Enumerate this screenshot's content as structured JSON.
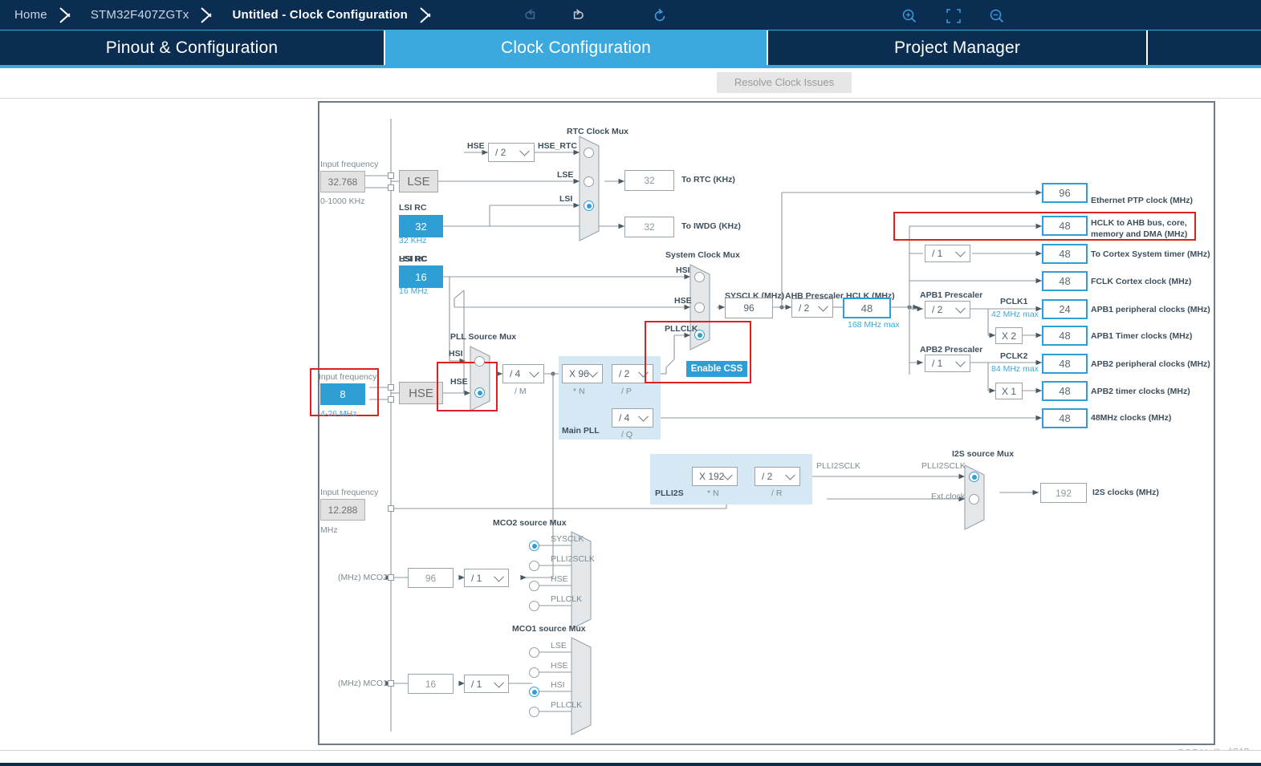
{
  "breadcrumb": {
    "items": [
      {
        "label": "Home",
        "active": false
      },
      {
        "label": "STM32F407ZGTx",
        "active": false
      },
      {
        "label": "Untitled - Clock Configuration",
        "active": true
      }
    ]
  },
  "tabs": [
    {
      "label": "Pinout & Configuration",
      "selected": false
    },
    {
      "label": "Clock Configuration",
      "selected": true
    },
    {
      "label": "Project Manager",
      "selected": false
    }
  ],
  "toolbar": {
    "undo_icon": "undo-icon",
    "redo_icon": "redo-icon",
    "reset_icon": "reset-icon",
    "resolve_label": "Resolve Clock Issues",
    "zoom_in_icon": "zoom-in-icon",
    "fit_icon": "fit-to-screen-icon",
    "zoom_out_icon": "zoom-out-icon"
  },
  "colors": {
    "navy": "#0b2d52",
    "accent_blue": "#3ba9dd",
    "fill_blue": "#2e9fd4",
    "highlight_red": "#e02020",
    "pll_bg": "#d7e8f5"
  },
  "clock": {
    "lse": {
      "input_frequency_label": "Input frequency",
      "value": "32.768",
      "range": "0-1000 KHz",
      "name": "LSE"
    },
    "lsi": {
      "title": "LSI RC",
      "value": "32",
      "unit": "32 KHz"
    },
    "hsi": {
      "title": "HSI RC",
      "value": "16",
      "unit": "16 MHz"
    },
    "hse": {
      "input_frequency_label": "Input frequency",
      "value": "8",
      "range": "4-26 MHz",
      "name": "HSE"
    },
    "i2s_input": {
      "input_frequency_label": "Input frequency",
      "value": "12.288",
      "unit": "MHz"
    },
    "rtc_mux": {
      "title": "RTC Clock Mux",
      "hse_label": "HSE",
      "hse_div": "/ 2",
      "hse_rtc_label": "HSE_RTC",
      "inputs": [
        "HSE_RTC",
        "LSE",
        "LSI"
      ],
      "selected": 2
    },
    "to_rtc": {
      "value": "32",
      "label": "To RTC (KHz)"
    },
    "to_iwdg": {
      "value": "32",
      "label": "To IWDG (KHz)"
    },
    "pll_source_mux": {
      "title": "PLL Source Mux",
      "inputs": [
        "HSI",
        "HSE"
      ],
      "selected": 1
    },
    "main_pll": {
      "title": "Main PLL",
      "m": {
        "value": "/ 4",
        "label": "/ M"
      },
      "n": {
        "value": "X 96",
        "label": "* N"
      },
      "p": {
        "value": "/ 2",
        "label": "/ P"
      },
      "q": {
        "value": "/ 4",
        "label": "/ Q"
      }
    },
    "plli2s": {
      "title": "PLLI2S",
      "n": {
        "value": "X 192",
        "label": "* N"
      },
      "r": {
        "value": "/ 2",
        "label": "/ R"
      },
      "out_label": "PLLI2SCLK"
    },
    "i2s_source_mux": {
      "title": "I2S source Mux",
      "inputs": [
        "PLLI2SCLK",
        "Ext.clock"
      ],
      "selected": 0
    },
    "i2s_clocks": {
      "value": "192",
      "label": "I2S clocks (MHz)"
    },
    "system_clock_mux": {
      "title": "System Clock Mux",
      "inputs": [
        "HSI",
        "HSE",
        "PLLCLK"
      ],
      "selected": 2,
      "enable_css": "Enable CSS"
    },
    "sysclk": {
      "title": "SYSCLK (MHz)",
      "value": "96"
    },
    "ahb_prescaler": {
      "title": "AHB Prescaler",
      "value": "/ 2"
    },
    "hclk": {
      "title": "HCLK (MHz)",
      "value": "48",
      "max": "168 MHz max"
    },
    "cortex_prescaler": {
      "value": "/ 1"
    },
    "apb1_prescaler": {
      "title": "APB1 Prescaler",
      "value": "/ 2"
    },
    "apb2_prescaler": {
      "title": "APB2 Prescaler",
      "value": "/ 1"
    },
    "pclk1": {
      "label": "PCLK1",
      "max": "42 MHz max"
    },
    "pclk2": {
      "label": "PCLK2",
      "max": "84 MHz max"
    },
    "apb1_timer_mult": "X 2",
    "apb2_timer_mult": "X 1",
    "outputs": [
      {
        "value": "96",
        "label": "Ethernet PTP clock (MHz)"
      },
      {
        "value": "48",
        "label": "HCLK to AHB bus, core, memory and DMA (MHz)"
      },
      {
        "value": "48",
        "label": "To Cortex System timer (MHz)"
      },
      {
        "value": "48",
        "label": "FCLK Cortex clock (MHz)"
      },
      {
        "value": "24",
        "label": "APB1 peripheral clocks (MHz)"
      },
      {
        "value": "48",
        "label": "APB1 Timer clocks (MHz)"
      },
      {
        "value": "48",
        "label": "APB2 peripheral clocks (MHz)"
      },
      {
        "value": "48",
        "label": "APB2 timer clocks (MHz)"
      },
      {
        "value": "48",
        "label": "48MHz clocks (MHz)"
      }
    ],
    "mco2": {
      "title": "MCO2 source Mux",
      "pin_label": "(MHz) MCO2",
      "value": "96",
      "divider": "/ 1",
      "inputs": [
        "SYSCLK",
        "PLLI2SCLK",
        "HSE",
        "PLLCLK"
      ],
      "selected": 0
    },
    "mco1": {
      "title": "MCO1 source Mux",
      "pin_label": "(MHz) MCO1",
      "value": "16",
      "divider": "/ 1",
      "inputs": [
        "LSE",
        "HSE",
        "HSI",
        "PLLCLK"
      ],
      "selected": 2
    }
  },
  "watermark": "CSDN @_旭旭_"
}
